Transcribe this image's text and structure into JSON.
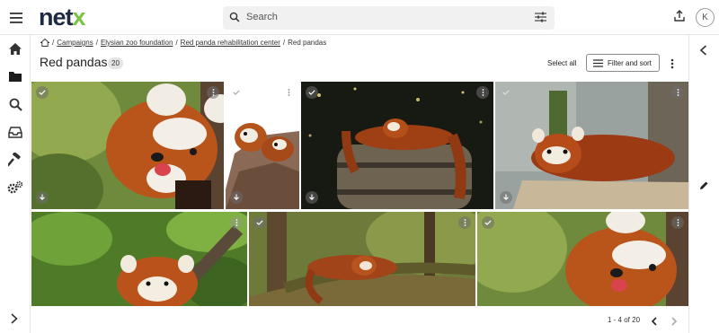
{
  "app": {
    "logo_part1": "net",
    "logo_part2": "x",
    "brand_colors": {
      "dark": "#1e2a44",
      "accent": "#7bc243"
    }
  },
  "search": {
    "placeholder": "Search"
  },
  "user": {
    "initial": "K"
  },
  "nav": {
    "items": [
      {
        "icon": "home-icon"
      },
      {
        "icon": "folder-icon"
      },
      {
        "icon": "search-icon"
      },
      {
        "icon": "inbox-icon"
      },
      {
        "icon": "hammer-icon"
      },
      {
        "icon": "gears-icon"
      }
    ],
    "expand_icon": "chevron-right-icon"
  },
  "breadcrumb": {
    "items": [
      "Campaigns",
      "Elysian zoo foundation",
      "Red panda rehabilitation center"
    ],
    "current": "Red pandas",
    "separator": "/"
  },
  "page": {
    "title": "Red pandas",
    "count": "20",
    "select_all": "Select all",
    "filter_sort": "Filter and sort"
  },
  "gallery": {
    "photos": [
      {
        "subject": "red panda close-up with tongue out"
      },
      {
        "subject": "two red pandas on a tree stump"
      },
      {
        "subject": "red panda lying on a wooden barrel"
      },
      {
        "subject": "red panda resting on a wooden platform"
      },
      {
        "subject": "red panda in green leaves"
      },
      {
        "subject": "red panda sleeping on a mossy branch"
      },
      {
        "subject": "red panda close-up with tongue out"
      }
    ]
  },
  "pagination": {
    "range_text": "1 - 4 of 20"
  }
}
